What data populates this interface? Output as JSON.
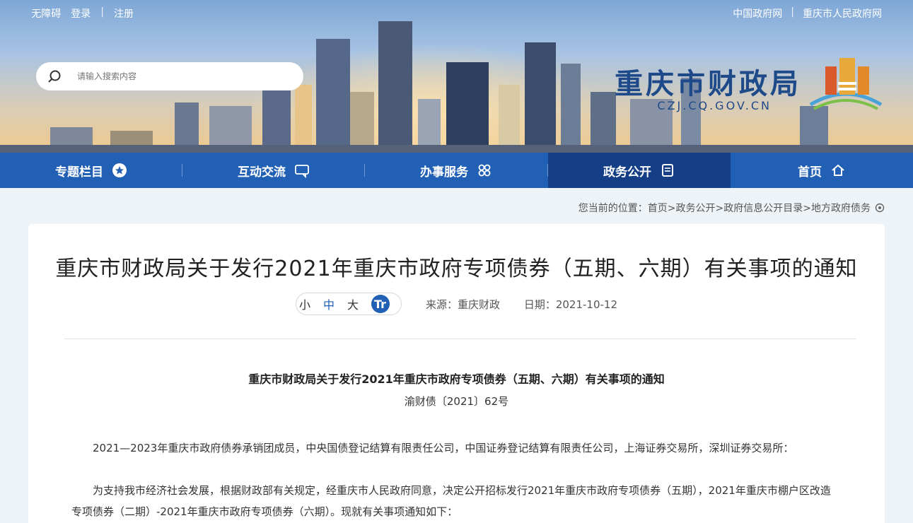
{
  "topbar": {
    "links_left": [
      "中国政府网",
      "重庆市人民政府网"
    ],
    "links_right": [
      "无障碍",
      "登录",
      "注册"
    ]
  },
  "logo": {
    "title": "重庆市财政局",
    "domain": "CZJ.CQ.GOV.CN"
  },
  "search": {
    "placeholder": "请输入搜索内容"
  },
  "nav": [
    {
      "label": "首页",
      "icon": "home-icon"
    },
    {
      "label": "政务公开",
      "icon": "document-icon",
      "active": true
    },
    {
      "label": "办事服务",
      "icon": "grid-icon"
    },
    {
      "label": "互动交流",
      "icon": "chat-icon"
    },
    {
      "label": "专题栏目",
      "icon": "star-icon"
    }
  ],
  "breadcrumb": "您当前的位置：首页>政务公开>政府信息公开目录>地方政府债务",
  "article": {
    "title": "重庆市财政局关于发行2021年重庆市政府专项债券（五期、六期）有关事项的通知",
    "date": "日期：2021-10-12",
    "source": "来源：重庆财政",
    "font_sizes": [
      "大",
      "中",
      "小"
    ],
    "font_icon": "Tr",
    "doc_heading": "重庆市财政局关于发行2021年重庆市政府专项债券（五期、六期）有关事项的通知",
    "doc_number": "渝财债〔2021〕62号",
    "para1": "2021—2023年重庆市政府债券承销团成员，中央国债登记结算有限责任公司，中国证券登记结算有限责任公司，上海证券交易所，深圳证券交易所：",
    "para2": "为支持我市经济社会发展，根据财政部有关规定，经重庆市人民政府同意，决定公开招标发行2021年重庆市政府专项债券（五期），2021年重庆市棚户区改造专项债券（二期）-2021年重庆市政府专项债券（六期）。现就有关事项通知如下："
  },
  "colors": {
    "nav": "#2160b5",
    "nav_active": "#143f86",
    "accent": "#2160b5"
  }
}
